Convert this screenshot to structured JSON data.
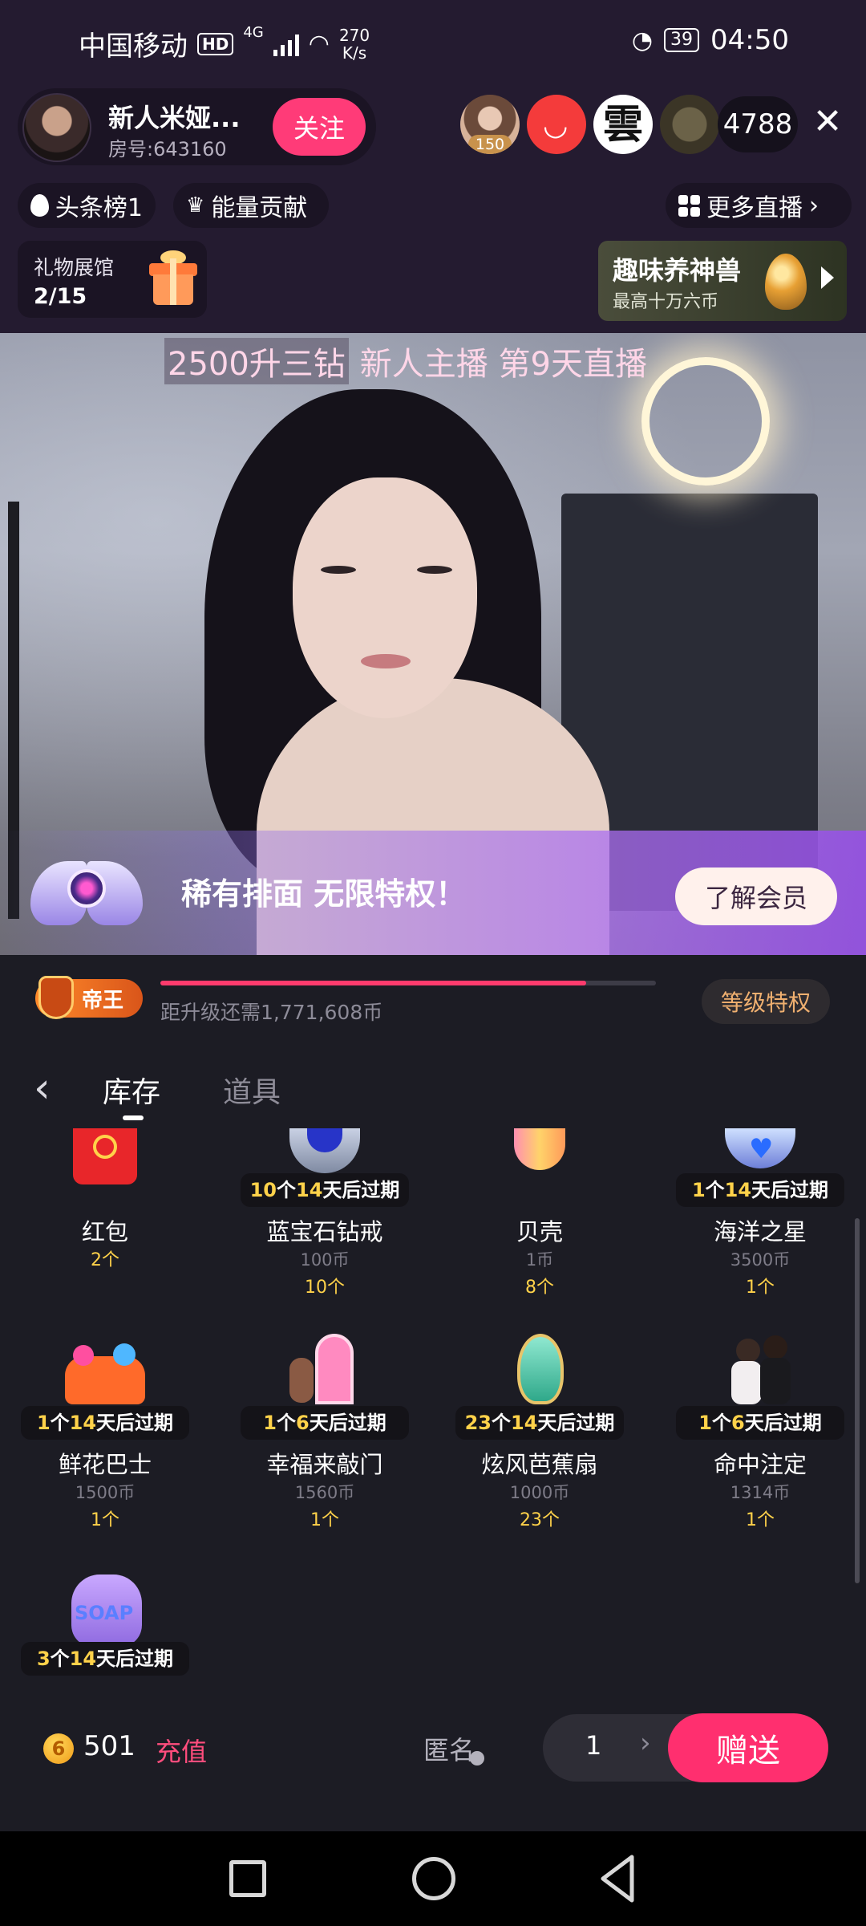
{
  "status_bar": {
    "carrier": "中国移动",
    "hd": "HD",
    "network": "4G",
    "net_speed_value": "270",
    "net_speed_unit": "K/s",
    "battery": "39",
    "time": "04:50"
  },
  "host": {
    "name": "新人米娅...",
    "room": "房号:643160",
    "follow_label": "关注"
  },
  "viewers": {
    "first_badge": "150",
    "third_avatar_char": "雲",
    "count": "4788"
  },
  "chips": {
    "headline_rank": "头条榜1",
    "energy": "能量贡献",
    "more_live": "更多直播"
  },
  "gift_hall": {
    "title": "礼物展馆",
    "count": "2/15"
  },
  "pet_banner": {
    "title": "趣味养神兽",
    "subtitle": "最高十万六币"
  },
  "video": {
    "headline_part1": "2500升三钻",
    "headline_part2": "新人主播 第9天直播",
    "vip_text": "稀有排面  无限特权！",
    "vip_button": "了解会员"
  },
  "level": {
    "badge": "帝王",
    "progress": 0.86,
    "hint": "距升级还需1,771,608币",
    "privilege_button": "等级特权"
  },
  "tabs": {
    "back_icon": "chevron-left-icon",
    "active": "库存",
    "inactive": "道具"
  },
  "items": [
    {
      "name": "红包",
      "price": "",
      "qty": "2个",
      "expiry_num": "",
      "expiry_text": ""
    },
    {
      "name": "蓝宝石钻戒",
      "price": "100币",
      "qty": "10个",
      "expiry_num": "10",
      "expiry_mid": "个",
      "expiry_days": "14",
      "expiry_text": "天后过期"
    },
    {
      "name": "贝壳",
      "price": "1币",
      "qty": "8个",
      "expiry_num": "",
      "expiry_text": ""
    },
    {
      "name": "海洋之星",
      "price": "3500币",
      "qty": "1个",
      "expiry_num": "1",
      "expiry_mid": "个",
      "expiry_days": "14",
      "expiry_text": "天后过期"
    },
    {
      "name": "鲜花巴士",
      "price": "1500币",
      "qty": "1个",
      "expiry_num": "1",
      "expiry_mid": "个",
      "expiry_days": "14",
      "expiry_text": "天后过期"
    },
    {
      "name": "幸福来敲门",
      "price": "1560币",
      "qty": "1个",
      "expiry_num": "1",
      "expiry_mid": "个",
      "expiry_days": "6",
      "expiry_text": "天后过期"
    },
    {
      "name": "炫风芭蕉扇",
      "price": "1000币",
      "qty": "23个",
      "expiry_num": "23",
      "expiry_mid": "个",
      "expiry_days": "14",
      "expiry_text": "天后过期"
    },
    {
      "name": "命中注定",
      "price": "1314币",
      "qty": "1个",
      "expiry_num": "1",
      "expiry_mid": "个",
      "expiry_days": "6",
      "expiry_text": "天后过期"
    },
    {
      "name": "",
      "price": "",
      "qty": "",
      "expiry_num": "3",
      "expiry_mid": "个",
      "expiry_days": "14",
      "expiry_text": "天后过期",
      "pic_label": "SOAP"
    }
  ],
  "bottom_bar": {
    "coin_glyph": "6",
    "balance": "501",
    "recharge": "充值",
    "anonymous": "匿名",
    "quantity": "1",
    "send": "赠送"
  },
  "colors": {
    "accent_pink": "#ff2f6f",
    "expiry_yellow": "#ffd24a",
    "panel_bg": "#1c1c24",
    "header_bg": "#241b30"
  }
}
